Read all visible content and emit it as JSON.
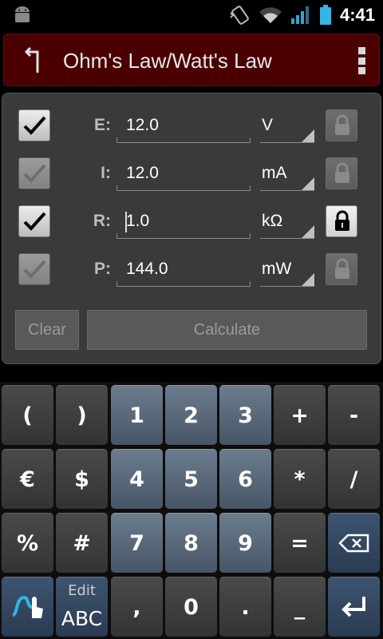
{
  "status_bar": {
    "time": "4:41",
    "icons": [
      "android-debug-icon",
      "vibrate-icon",
      "wifi-icon",
      "signal-icon",
      "battery-icon"
    ]
  },
  "action_bar": {
    "title": "Ohm's Law/Watt's Law",
    "icons": [
      "back-arrow-icon",
      "overflow-menu-icon"
    ]
  },
  "rows": [
    {
      "label": "E:",
      "value": "12.0",
      "unit": "V",
      "checked": true,
      "enabled": true,
      "locked": false
    },
    {
      "label": "I:",
      "value": "12.0",
      "unit": "mA",
      "checked": true,
      "enabled": false,
      "locked": false
    },
    {
      "label": "R:",
      "value": "1.0",
      "unit": "kΩ",
      "checked": true,
      "enabled": true,
      "locked": true
    },
    {
      "label": "P:",
      "value": "144.0",
      "unit": "mW",
      "checked": true,
      "enabled": false,
      "locked": false
    }
  ],
  "buttons": {
    "clear": "Clear",
    "calculate": "Calculate"
  },
  "keyboard": {
    "rows": [
      [
        "(",
        ")",
        "1",
        "2",
        "3",
        "+",
        "-"
      ],
      [
        "€",
        "$",
        "4",
        "5",
        "6",
        "*",
        "/"
      ],
      [
        "%",
        "#",
        "7",
        "8",
        "9",
        "=",
        ""
      ],
      [
        "",
        "",
        ",",
        "0",
        ".",
        "_",
        ""
      ]
    ],
    "edit_top": "Edit",
    "edit_bottom": "ABC",
    "icons": [
      "backspace-icon",
      "swipe-hand-icon",
      "enter-icon"
    ]
  },
  "colors": {
    "action_bar_bg": "#4a0000",
    "panel_bg": "#3a3a3a",
    "number_key": "#5a6b7c",
    "action_key": "#2f4560"
  }
}
